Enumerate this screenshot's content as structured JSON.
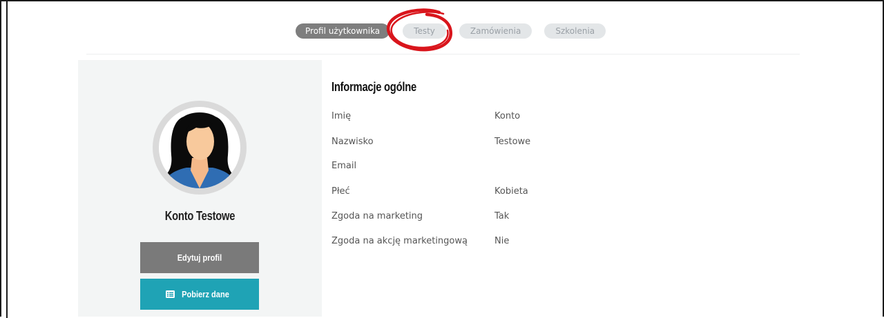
{
  "tabs": [
    {
      "label": "Profil użytkownika",
      "active": true
    },
    {
      "label": "Testy",
      "active": false
    },
    {
      "label": "Zamówienia",
      "active": false
    },
    {
      "label": "Szkolenia",
      "active": false
    }
  ],
  "profile": {
    "name": "Konto Testowe",
    "edit_button": "Edytuj profil",
    "download_button": "Pobierz dane",
    "download_icon": "list-alt-icon"
  },
  "info": {
    "title": "Informacje ogólne",
    "rows": [
      {
        "label": "Imię",
        "value": "Konto"
      },
      {
        "label": "Nazwisko",
        "value": "Testowe"
      },
      {
        "label": "Email",
        "value": ""
      },
      {
        "label": "Płeć",
        "value": "Kobieta"
      },
      {
        "label": "Zgoda na marketing",
        "value": "Tak"
      },
      {
        "label": "Zgoda na akcję marketingową",
        "value": "Nie"
      }
    ]
  },
  "colors": {
    "active_tab": "#7e7e7e",
    "inactive_tab": "#e3e6e8",
    "edit_button": "#7a7a7a",
    "download_button": "#1fa3b5",
    "annotation_circle": "#d9151c"
  }
}
